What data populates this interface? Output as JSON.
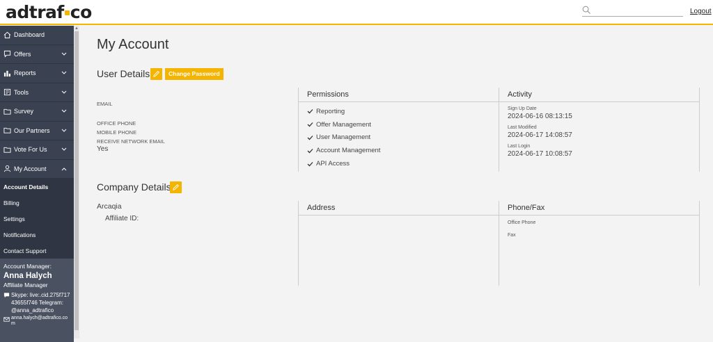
{
  "header": {
    "logo_left": "adtraf",
    "logo_right": "co",
    "search_placeholder": "",
    "logout_label": "Logout"
  },
  "sidebar": {
    "items": [
      {
        "label": "Dashboard",
        "icon": "home-icon"
      },
      {
        "label": "Offers",
        "icon": "chat-icon"
      },
      {
        "label": "Reports",
        "icon": "chart-icon"
      },
      {
        "label": "Tools",
        "icon": "tools-icon"
      },
      {
        "label": "Survey",
        "icon": "folder-icon"
      },
      {
        "label": "Our Partners",
        "icon": "folder-icon"
      },
      {
        "label": "Vote For Us",
        "icon": "folder-icon"
      },
      {
        "label": "My Account",
        "icon": "user-icon"
      }
    ],
    "sub_items": [
      {
        "label": "Account Details",
        "active": true
      },
      {
        "label": "Billing"
      },
      {
        "label": "Settings"
      },
      {
        "label": "Notifications"
      },
      {
        "label": "Contact Support"
      }
    ],
    "manager": {
      "label": "Account Manager:",
      "name": "Anna Halych",
      "role": "Affiliate Manager",
      "skype": "Skype: live:.cid.275f71743655f746 Telegram: @anna_adtrafico",
      "email": "anna.halych@adtrafico.com"
    }
  },
  "main": {
    "title": "My Account",
    "user_details": {
      "title": "User Details",
      "change_password": "Change Password",
      "fields": {
        "email_label": "EMAIL",
        "office_phone_label": "OFFICE PHONE",
        "mobile_phone_label": "MOBILE PHONE",
        "receive_email_label": "RECEIVE NETWORK EMAIL",
        "receive_email_value": "Yes"
      },
      "permissions_title": "Permissions",
      "permissions": [
        "Reporting",
        "Offer Management",
        "User Management",
        "Account Management",
        "API Access"
      ],
      "activity_title": "Activity",
      "activity": [
        {
          "label": "Sign Up Date",
          "value": "2024-06-16 08:13:15"
        },
        {
          "label": "Last Modified",
          "value": "2024-06-17 14:08:57"
        },
        {
          "label": "Last Login",
          "value": "2024-06-17 10:08:57"
        }
      ]
    },
    "company_details": {
      "title": "Company Details",
      "company_name": "Arcaqia",
      "affiliate_id_label": "Affiliate ID:",
      "address_title": "Address",
      "phone_fax_title": "Phone/Fax",
      "office_phone_label": "Office Phone",
      "fax_label": "Fax"
    }
  },
  "colors": {
    "accent": "#f4b400",
    "sidebar_bg": "#3a4150",
    "background": "#f3f3f3"
  }
}
